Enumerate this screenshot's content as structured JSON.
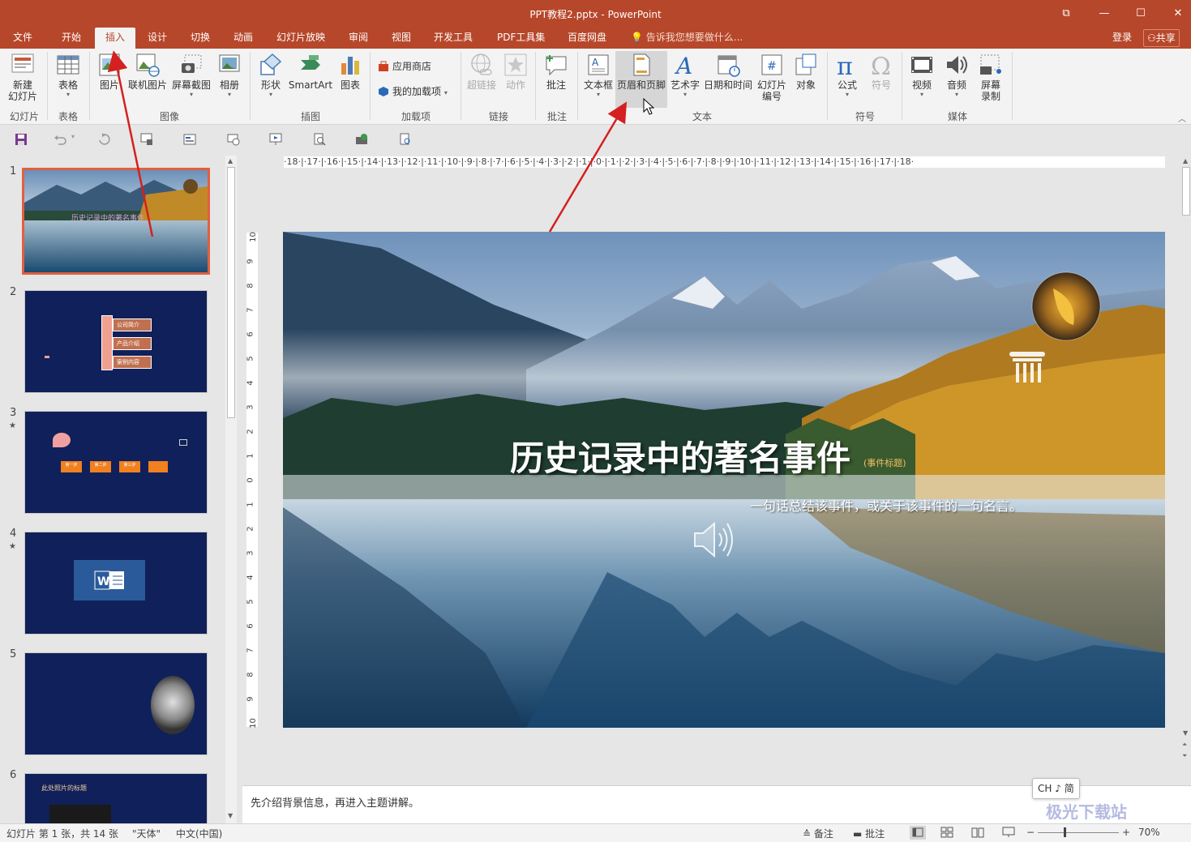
{
  "window": {
    "title": "PPT教程2.pptx - PowerPoint",
    "restore_glyph": "⧉",
    "minimize_glyph": "—",
    "maximize_glyph": "☐",
    "close_glyph": "✕"
  },
  "tabs": [
    {
      "label": "文件"
    },
    {
      "label": "开始"
    },
    {
      "label": "插入"
    },
    {
      "label": "设计"
    },
    {
      "label": "切换"
    },
    {
      "label": "动画"
    },
    {
      "label": "幻灯片放映"
    },
    {
      "label": "审阅"
    },
    {
      "label": "视图"
    },
    {
      "label": "开发工具"
    },
    {
      "label": "PDF工具集"
    },
    {
      "label": "百度网盘"
    }
  ],
  "tell_me": "告诉我您想要做什么...",
  "login": "登录",
  "share": "共享",
  "ribbon": {
    "new_slide": "新建\n幻灯片",
    "table": "表格",
    "picture": "图片",
    "online_picture": "联机图片",
    "screenshot": "屏幕截图",
    "album": "相册",
    "shapes": "形状",
    "smartart": "SmartArt",
    "chart": "图表",
    "store": "应用商店",
    "my_addins": "我的加载项",
    "hyperlink": "超链接",
    "action": "动作",
    "comment": "批注",
    "textbox": "文本框",
    "header_footer": "页眉和页脚",
    "wordart": "艺术字",
    "datetime": "日期和时间",
    "slide_number_1": "幻灯片",
    "slide_number_2": "编号",
    "object": "对象",
    "equation": "公式",
    "symbol": "符号",
    "video": "视频",
    "audio": "音频",
    "screen_rec_1": "屏幕",
    "screen_rec_2": "录制",
    "groups": {
      "slides": "幻灯片",
      "tables": "表格",
      "images": "图像",
      "illustrations": "插图",
      "addins": "加载项",
      "links": "链接",
      "comments": "批注",
      "text": "文本",
      "symbols": "符号",
      "media": "媒体"
    },
    "colors": {
      "accent": "#b7472a",
      "ribbon_bg": "#f3f3f3"
    }
  },
  "ruler": {
    "horizontal": "·18·|·17·|·16·|·15·|·14·|·13·|·12·|·11·|·10·|·9·|·8·|·7·|·6·|·5·|·4·|·3·|·2·|·1·|·0·|·1·|·2·|·3·|·4·|·5·|·6·|·7·|·8·|·9·|·10·|·11·|·12·|·13·|·14·|·15·|·16·|·17·|·18·",
    "vertical": [
      "10",
      "9",
      "8",
      "7",
      "6",
      "5",
      "4",
      "3",
      "2",
      "1",
      "0",
      "1",
      "2",
      "3",
      "4",
      "5",
      "6",
      "7",
      "8",
      "9",
      "10"
    ]
  },
  "thumbnails": [
    {
      "number": "1",
      "star": ""
    },
    {
      "number": "2",
      "star": ""
    },
    {
      "number": "3",
      "star": "★"
    },
    {
      "number": "4",
      "star": "★"
    },
    {
      "number": "5",
      "star": ""
    },
    {
      "number": "6",
      "star": ""
    }
  ],
  "thumb2_items": [
    "公司简介",
    "产品介绍",
    "案例内容"
  ],
  "thumb3_items": [
    "第一步",
    "第二步",
    "第三步",
    ""
  ],
  "thumb6_title": "此处照片的标题",
  "slide": {
    "title": "历史记录中的著名事件",
    "tag": "(事件标题)",
    "subtitle": "一句话总结该事件，或关于该事件的一句名言。"
  },
  "notes": "先介绍背景信息，再进入主题讲解。",
  "ime": "CH ♪ 简",
  "status": {
    "slide_info": "幻灯片 第 1 张，共 14 张",
    "theme": "\"天体\"",
    "language": "中文(中国)",
    "notes_btn": "备注",
    "comments_btn": "批注",
    "zoom": "70%"
  },
  "watermark": "极光下载站"
}
